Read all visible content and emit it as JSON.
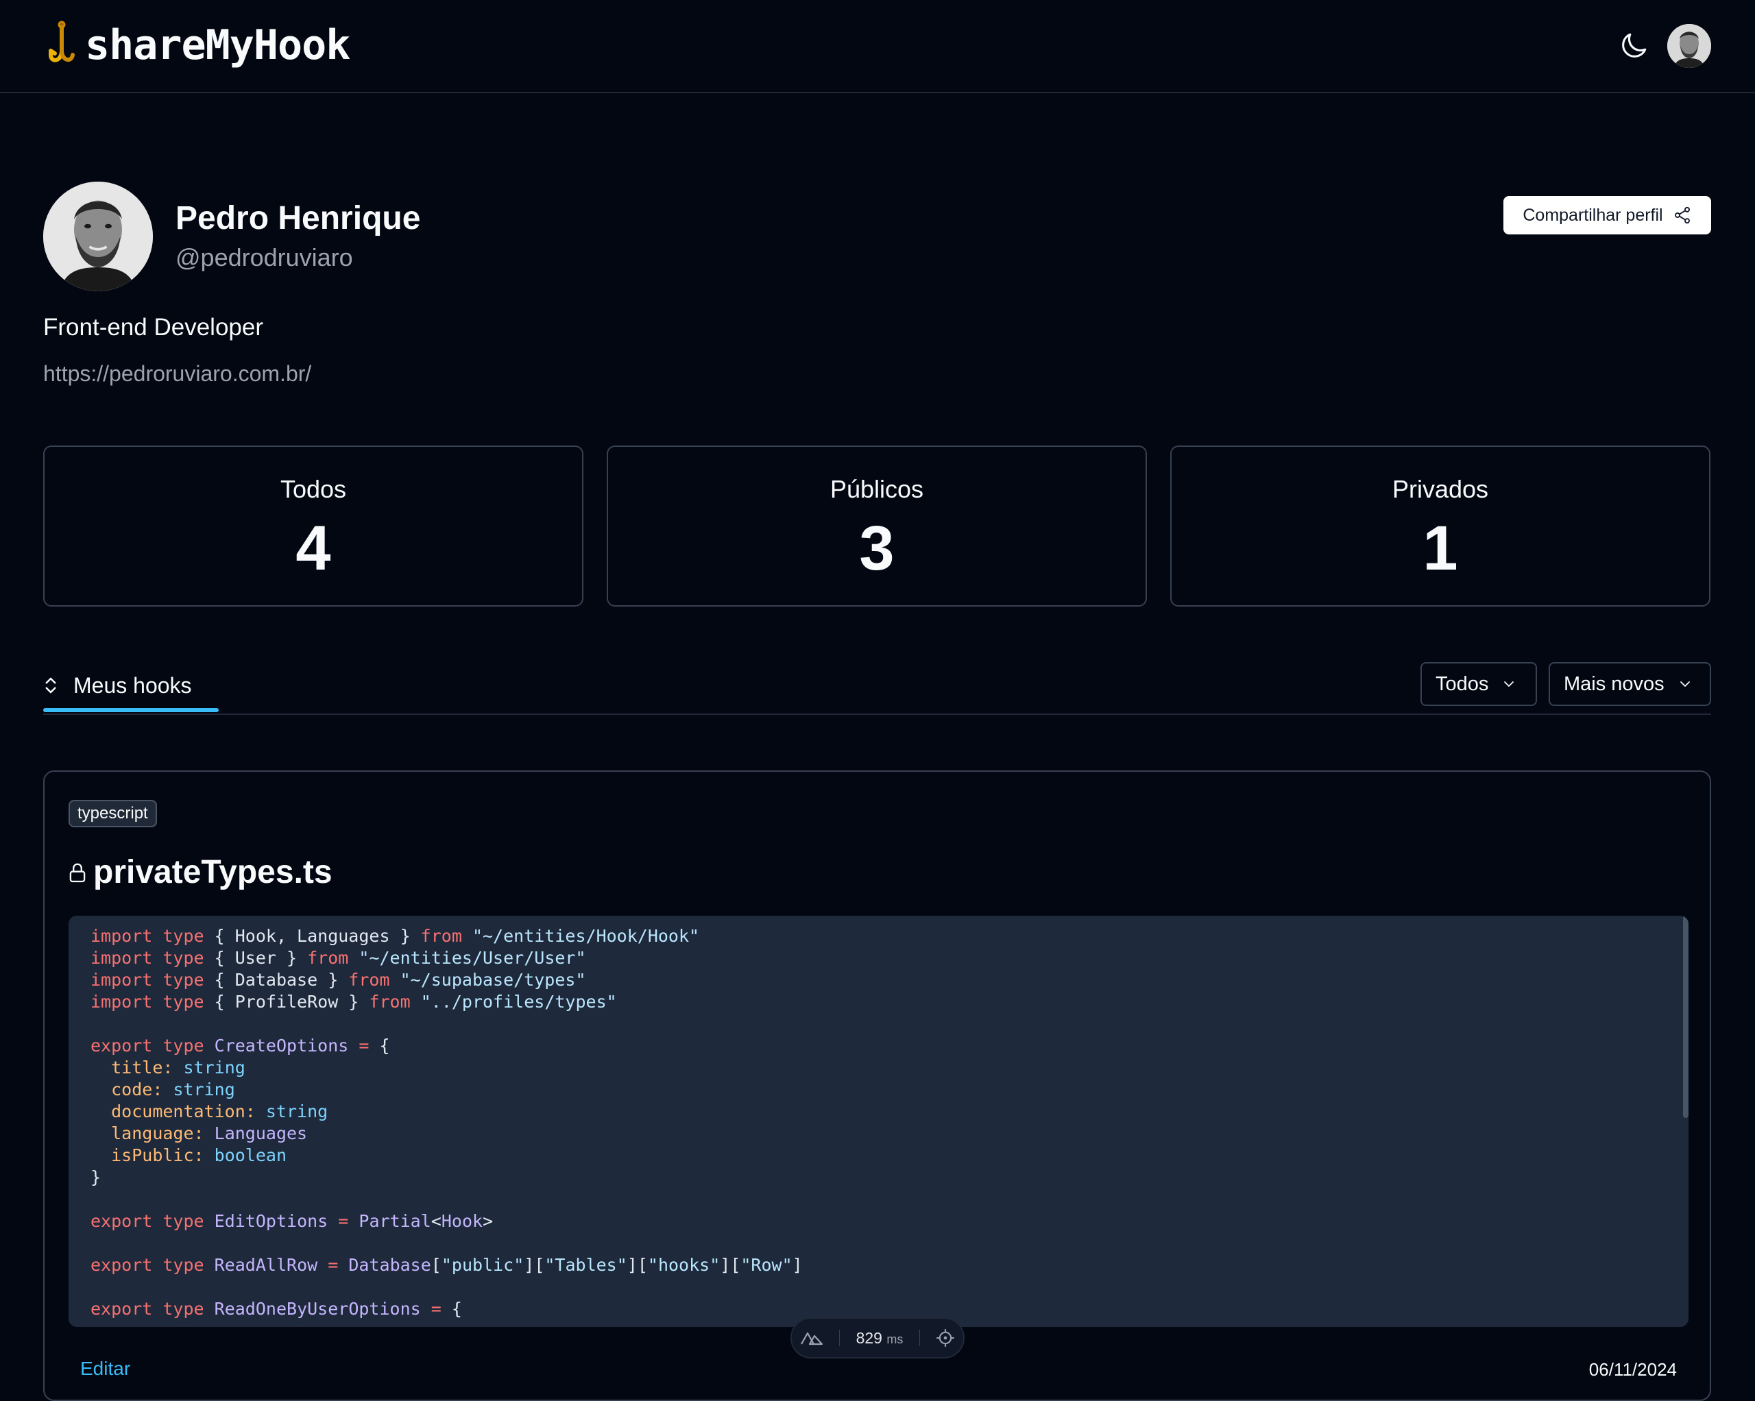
{
  "header": {
    "logo_text": "shareMyHook",
    "logo_icon": "hook-icon",
    "theme_icon": "moon-icon",
    "avatar_icon": "user-avatar"
  },
  "profile": {
    "name": "Pedro Henrique",
    "username": "@pedrodruviaro",
    "bio": "Front-end Developer",
    "website": "https://pedroruviaro.com.br/",
    "share_label": "Compartilhar perfil",
    "share_icon": "share-icon"
  },
  "stats": [
    {
      "label": "Todos",
      "value": "4"
    },
    {
      "label": "Públicos",
      "value": "3"
    },
    {
      "label": "Privados",
      "value": "1"
    }
  ],
  "tabs": {
    "active_label": "Meus hooks",
    "active_icon": "chevrons-up-down-icon"
  },
  "filters": {
    "visibility_selected": "Todos",
    "order_selected": "Mais novos"
  },
  "hook": {
    "language": "typescript",
    "title": "privateTypes.ts",
    "visibility_icon": "lock-icon",
    "code_lines": [
      "import type { Hook, Languages } from \"~/entities/Hook/Hook\"",
      "import type { User } from \"~/entities/User/User\"",
      "import type { Database } from \"~/supabase/types\"",
      "import type { ProfileRow } from \"../profiles/types\"",
      "",
      "export type CreateOptions = {",
      "  title: string",
      "  code: string",
      "  documentation: string",
      "  language: Languages",
      "  isPublic: boolean",
      "}",
      "",
      "export type EditOptions = Partial<Hook>",
      "",
      "export type ReadAllRow = Database[\"public\"][\"Tables\"][\"hooks\"][\"Row\"]",
      "",
      "export type ReadOneByUserOptions = {"
    ],
    "edit_label": "Editar",
    "date": "06/11/2024"
  },
  "devtools": {
    "render_time": "829",
    "render_unit": "ms",
    "nuxt_icon": "nuxt-icon",
    "inspect_icon": "target-icon"
  }
}
